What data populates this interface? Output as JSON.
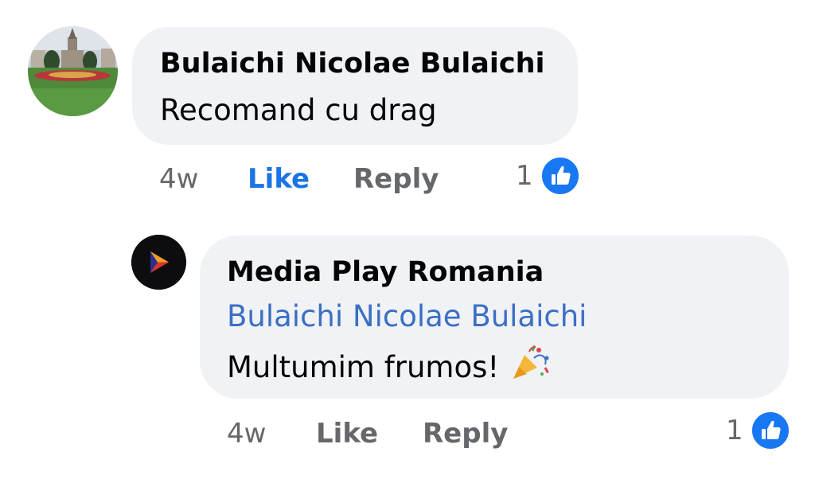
{
  "comments": [
    {
      "author": "Bulaichi Nicolae Bulaichi",
      "text": "Recomand cu drag",
      "time": "4w",
      "like_label": "Like",
      "reply_label": "Reply",
      "reaction_count": "1",
      "liked": true
    }
  ],
  "reply": {
    "author": "Media Play Romania",
    "mention": "Bulaichi Nicolae Bulaichi",
    "text": "Multumim frumos! 🎉",
    "time": "4w",
    "like_label": "Like",
    "reply_label": "Reply",
    "reaction_count": "1"
  },
  "colors": {
    "bubble": "#f0f2f5",
    "like_blue": "#1b74e4",
    "meta_gray": "#65676b",
    "mention_blue": "#3b6fc4"
  },
  "icons": [
    "like-thumb-icon",
    "play-logo-icon",
    "party-popper-icon"
  ]
}
